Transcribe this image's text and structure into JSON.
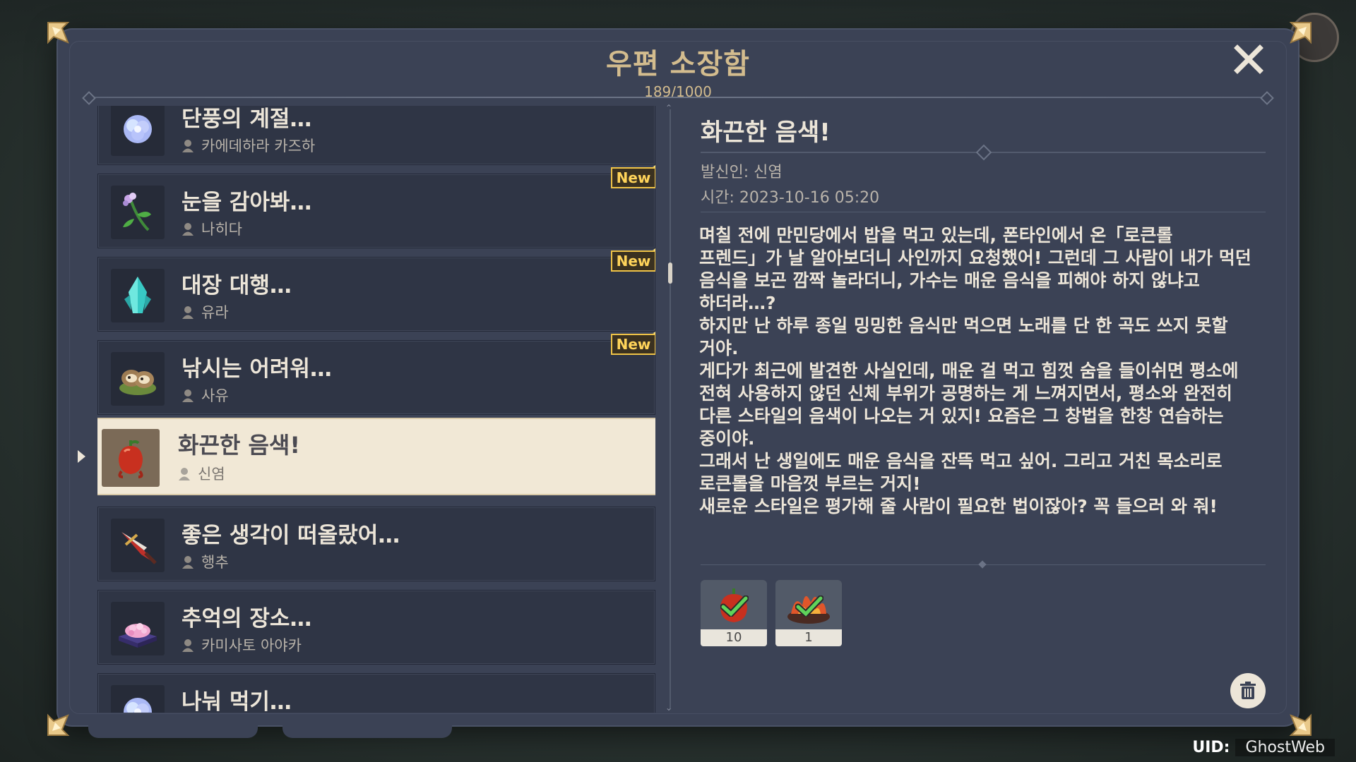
{
  "mailbox": {
    "title": "우편 소장함",
    "count": "189/1000"
  },
  "mail_list": [
    {
      "subject": "단풍의 계절…",
      "sender": "카에데하라 카즈하",
      "is_new": false,
      "icon": "crystal-flower-icon",
      "selected": false
    },
    {
      "subject": "눈을 감아봐…",
      "sender": "나히다",
      "is_new": true,
      "icon": "flower-stem-icon",
      "selected": false
    },
    {
      "subject": "대장 대행…",
      "sender": "유라",
      "is_new": true,
      "icon": "ice-crystal-icon",
      "selected": false
    },
    {
      "subject": "낚시는 어려워…",
      "sender": "사유",
      "is_new": true,
      "icon": "tanuki-icon",
      "selected": false
    },
    {
      "subject": "화끈한 음색!",
      "sender": "신염",
      "is_new": false,
      "icon": "pepper-icon",
      "selected": true
    },
    {
      "subject": "좋은 생각이 떠올랐어…",
      "sender": "행추",
      "is_new": false,
      "icon": "red-claymore-icon",
      "selected": false
    },
    {
      "subject": "추억의 장소…",
      "sender": "카미사토 아야카",
      "is_new": false,
      "icon": "pink-cake-icon",
      "selected": false
    },
    {
      "subject": "나눠 먹기…",
      "sender": "",
      "is_new": false,
      "icon": "crystal-flower-icon",
      "selected": false
    }
  ],
  "new_badge_label": "New",
  "detail": {
    "title": "화끈한 음색!",
    "from": "발신인: 신염",
    "time": "시간: 2023-10-16 05:20",
    "body": "며칠 전에 만민당에서 밥을 먹고 있는데, 폰타인에서 온「로큰롤\n프렌드」가 날 알아보더니 사인까지 요청했어! 그런데 그 사람이 내가 먹던\n음식을 보곤 깜짝 놀라더니, 가수는 매운 음식을 피해야 하지 않냐고\n하더라…?\n하지만 난 하루 종일 밍밍한 음식만 먹으면 노래를 단 한 곡도 쓰지 못할\n거야.\n게다가 최근에 발견한 사실인데, 매운 걸 먹고 힘껏 숨을 들이쉬면 평소에\n전혀 사용하지 않던 신체 부위가 공명하는 게 느껴지면서, 평소와 완전히\n다른 스타일의 음색이 나오는 거 있지! 요즘은 그 창법을 한창 연습하는\n중이야.\n그래서 난 생일에도 매운 음식을 잔뜩 먹고 싶어. 그리고 거친 목소리로\n로큰롤을 마음껏 부르는 거지!\n새로운 스타일은 평가해 줄 사람이 필요한 법이잖아? 꼭 들으러 와 줘!",
    "rewards": [
      {
        "icon": "pepper-item-icon",
        "count": "10",
        "claimed": true
      },
      {
        "icon": "fiery-dish-icon",
        "count": "1",
        "claimed": true
      }
    ]
  },
  "footer": {
    "uid_label": "UID:",
    "uid_value": "GhostWeb"
  },
  "colors": {
    "panel": "#3b4255",
    "gold_title": "#d3bc8e",
    "new_badge": "#f0c447",
    "selected_item": "#f1e8d6"
  }
}
